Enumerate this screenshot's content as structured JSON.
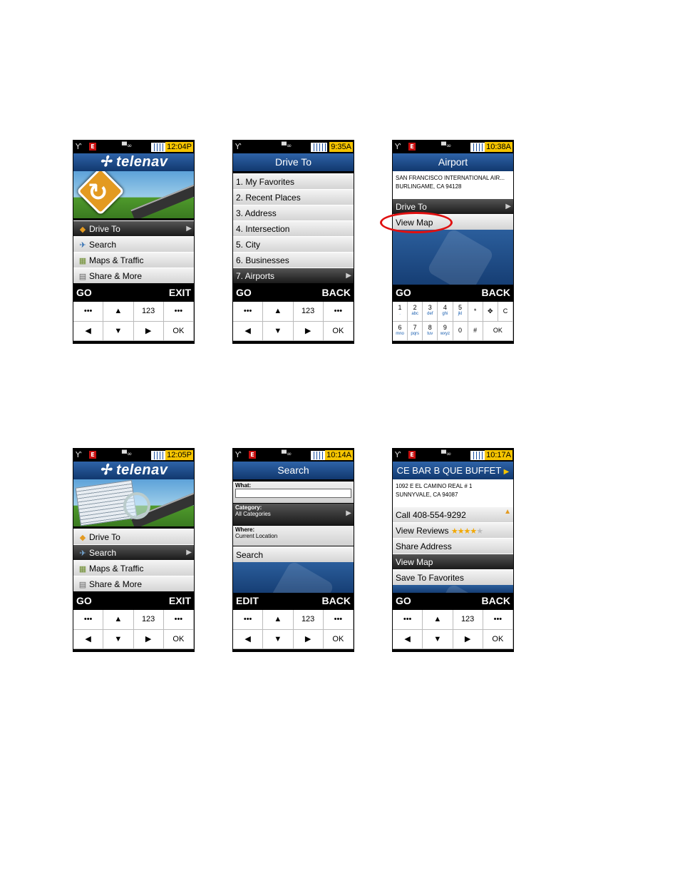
{
  "status_icons": {
    "antenna": "antenna-icon",
    "e": "E",
    "tty": "tty-icon",
    "battery": "battery-icon"
  },
  "screens": [
    {
      "time": "12:04P",
      "logo": "telenav",
      "menu": [
        "Drive To",
        "Search",
        "Maps & Traffic",
        "Share & More"
      ],
      "softkeys": {
        "left": "GO",
        "right": "EXIT"
      }
    },
    {
      "time": "9:35A",
      "title": "Drive To",
      "menu": [
        "1. My Favorites",
        "2. Recent Places",
        "3. Address",
        "4. Intersection",
        "5. City",
        "6. Businesses",
        "7. Airports"
      ],
      "softkeys": {
        "left": "GO",
        "right": "BACK"
      }
    },
    {
      "time": "10:38A",
      "title": "Airport",
      "address": [
        "SAN FRANCISCO INTERNATIONAL AIR...",
        "BURLINGAME, CA 94128"
      ],
      "menu": [
        "Drive To",
        "View Map"
      ],
      "softkeys": {
        "left": "GO",
        "right": "BACK"
      }
    },
    {
      "time": "12:05P",
      "logo": "telenav",
      "menu": [
        "Drive To",
        "Search",
        "Maps & Traffic",
        "Share & More"
      ],
      "softkeys": {
        "left": "GO",
        "right": "EXIT"
      }
    },
    {
      "time": "10:14A",
      "title": "Search",
      "what_label": "What:",
      "category_label": "Category:",
      "category_value": "All Categories",
      "where_label": "Where:",
      "where_value": "Current Location",
      "search_label": "Search",
      "softkeys": {
        "left": "EDIT",
        "right": "BACK"
      }
    },
    {
      "time": "10:17A",
      "title": "CE BAR B QUE BUFFET",
      "address": [
        "1092 E EL CAMINO REAL # 1",
        "SUNNYVALE, CA 94087"
      ],
      "menu": [
        "Call 408-554-9292",
        "View Reviews",
        "Share Address",
        "View Map",
        "Save To Favorites"
      ],
      "rating": 4,
      "softkeys": {
        "left": "GO",
        "right": "BACK"
      }
    }
  ],
  "keypad": [
    "•••",
    "▲",
    "123",
    "•••",
    "◀",
    "▼",
    "▶",
    "OK"
  ],
  "numpad": [
    {
      "d": "1",
      "s": "."
    },
    {
      "d": "2",
      "s": "abc"
    },
    {
      "d": "3",
      "s": "def"
    },
    {
      "d": "4",
      "s": "ghi"
    },
    {
      "d": "5",
      "s": "jkl"
    },
    {
      "d": "*",
      "s": ""
    },
    {
      "d": "✥",
      "s": ""
    },
    {
      "d": "C",
      "s": ""
    },
    {
      "d": "6",
      "s": "mno"
    },
    {
      "d": "7",
      "s": "pqrs"
    },
    {
      "d": "8",
      "s": "tuv"
    },
    {
      "d": "9",
      "s": "wxyz"
    },
    {
      "d": "0",
      "s": ""
    },
    {
      "d": "#",
      "s": ""
    },
    {
      "d": "OK",
      "s": ""
    },
    {
      "d": "",
      "s": ""
    }
  ]
}
